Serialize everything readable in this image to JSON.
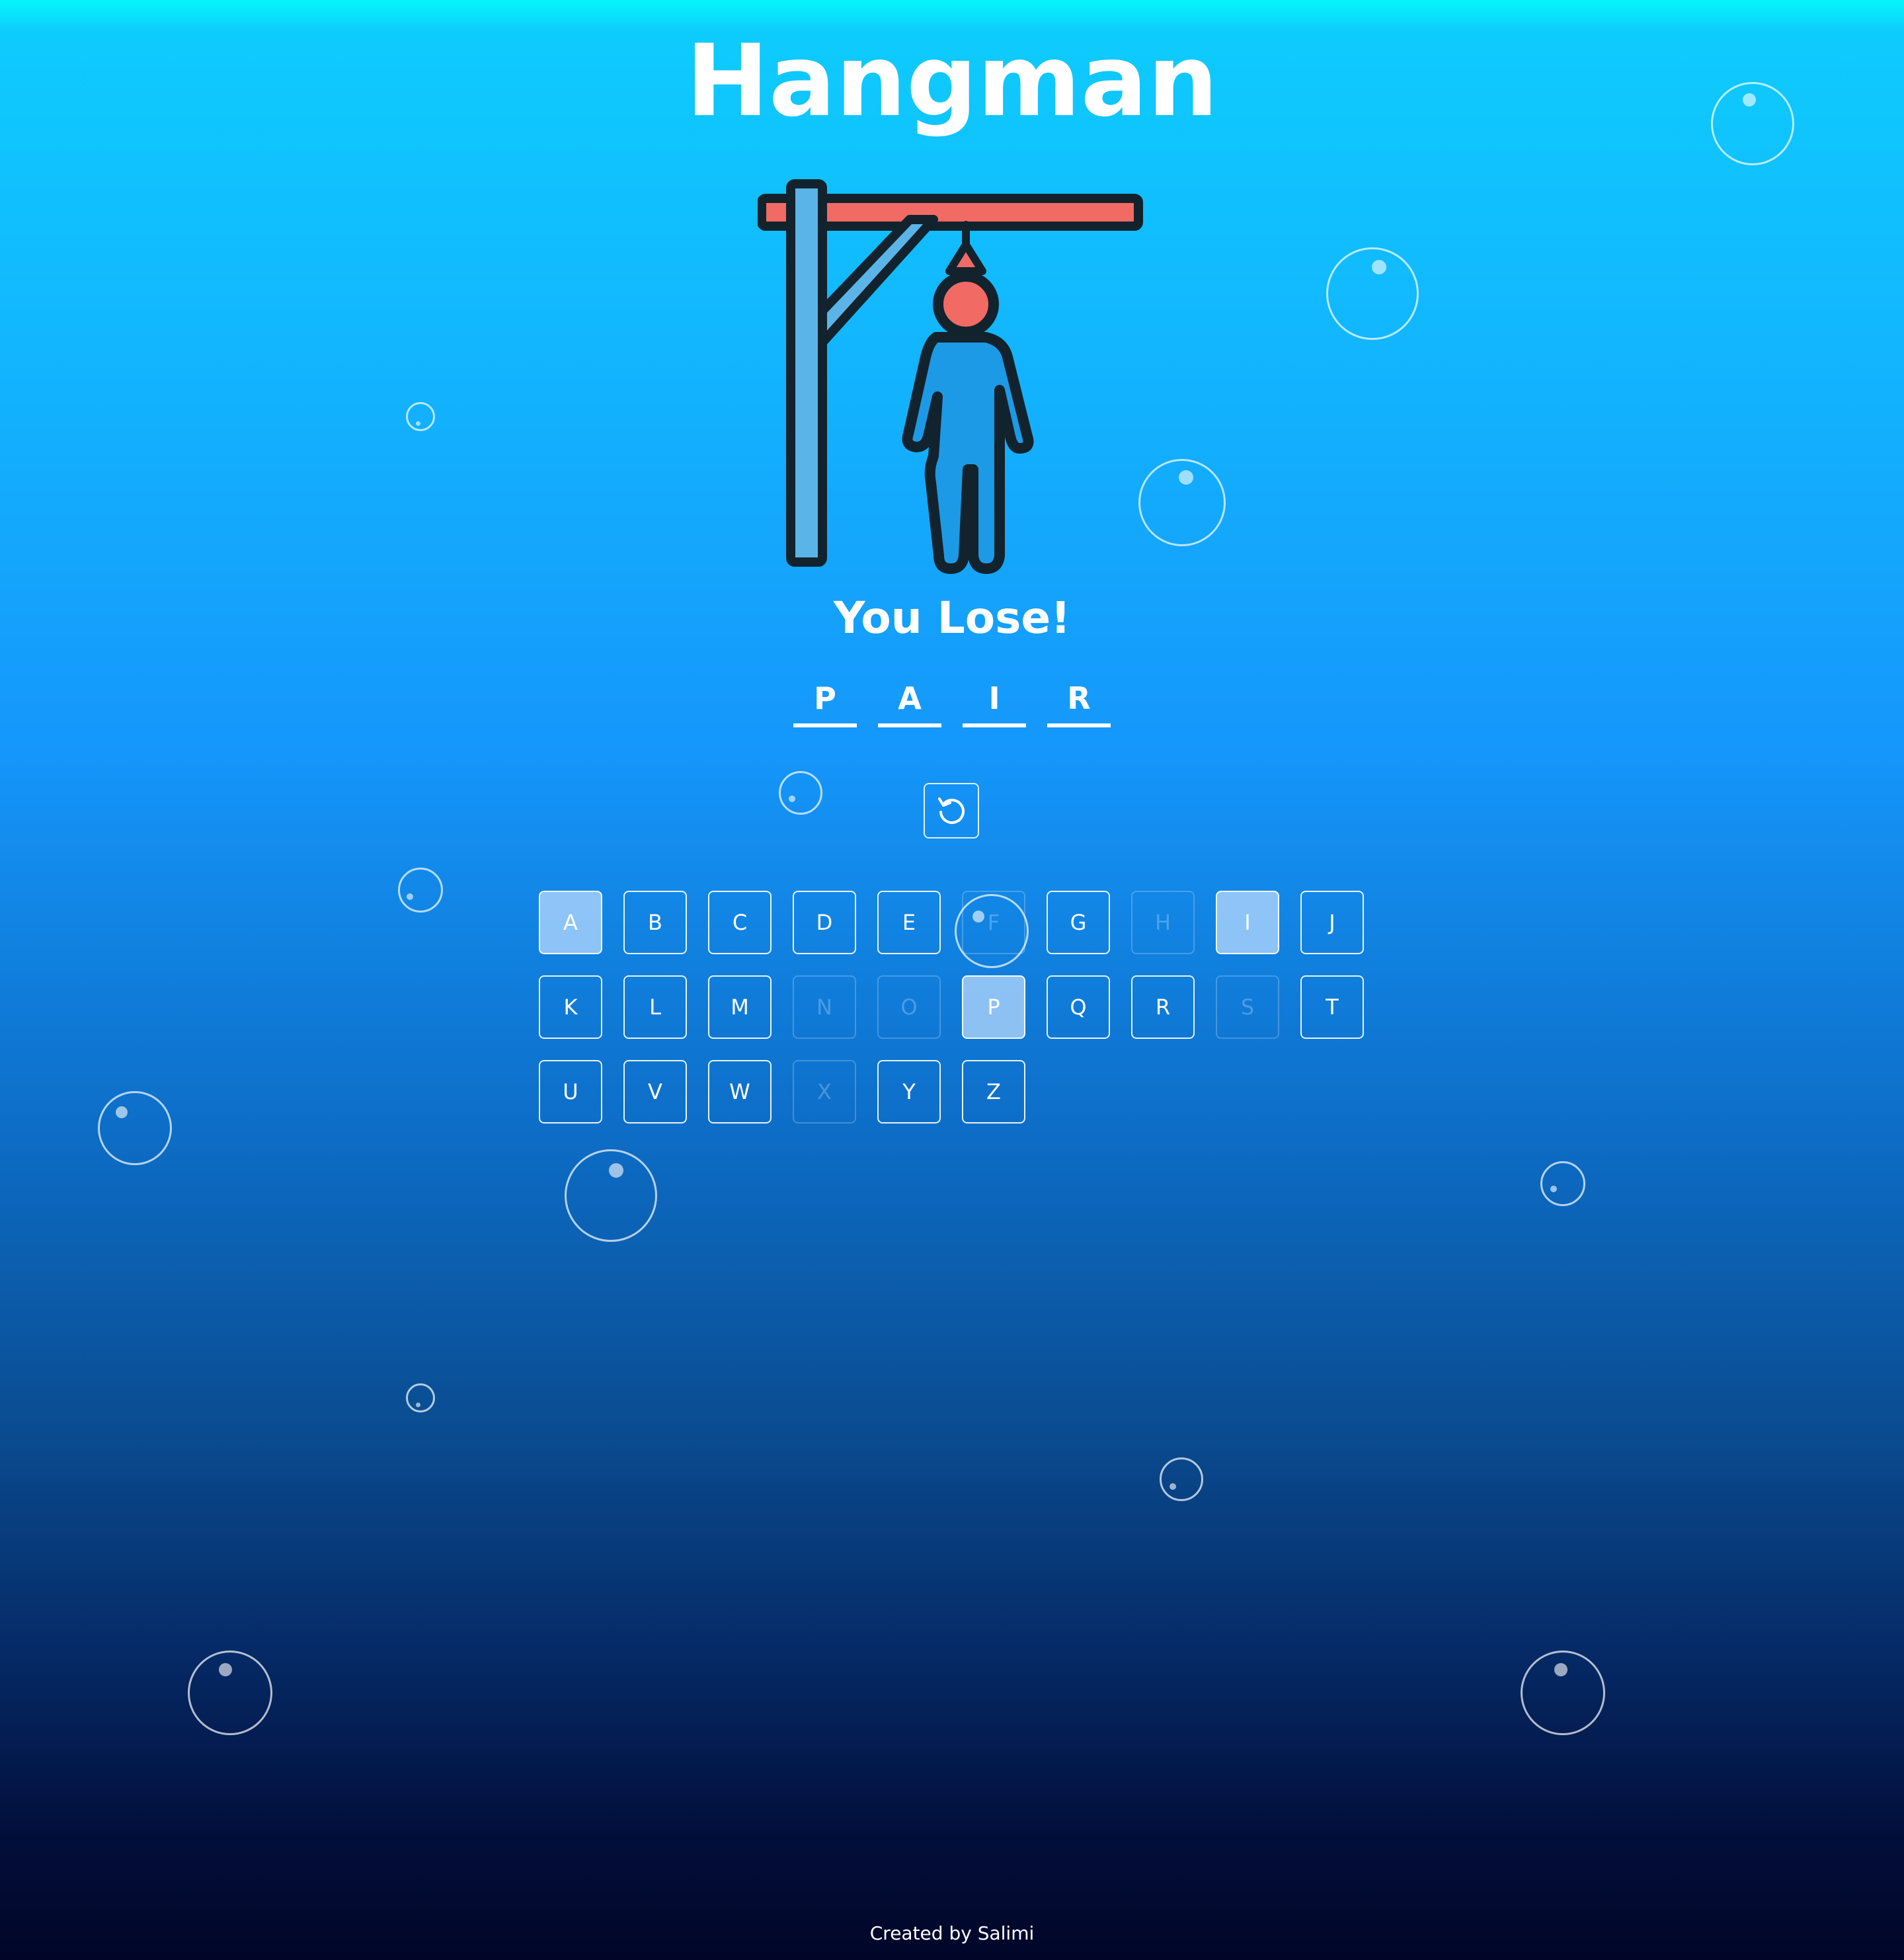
{
  "title": "Hangman",
  "status": "You Lose!",
  "word": [
    "P",
    "A",
    "I",
    "R"
  ],
  "reset_icon": "reset-icon",
  "keyboard": {
    "letters": [
      "A",
      "B",
      "C",
      "D",
      "E",
      "F",
      "G",
      "H",
      "I",
      "J",
      "K",
      "L",
      "M",
      "N",
      "O",
      "P",
      "Q",
      "R",
      "S",
      "T",
      "U",
      "V",
      "W",
      "X",
      "Y",
      "Z"
    ],
    "correct": [
      "A",
      "I",
      "P"
    ],
    "wrong": [
      "F",
      "H",
      "N",
      "O",
      "S",
      "X"
    ]
  },
  "footer": "Created by Salimi",
  "colors": {
    "rope_beam": "#f26a64",
    "post": "#5ab4e8",
    "figure": "#1d9ae6",
    "outline": "#12232e"
  }
}
